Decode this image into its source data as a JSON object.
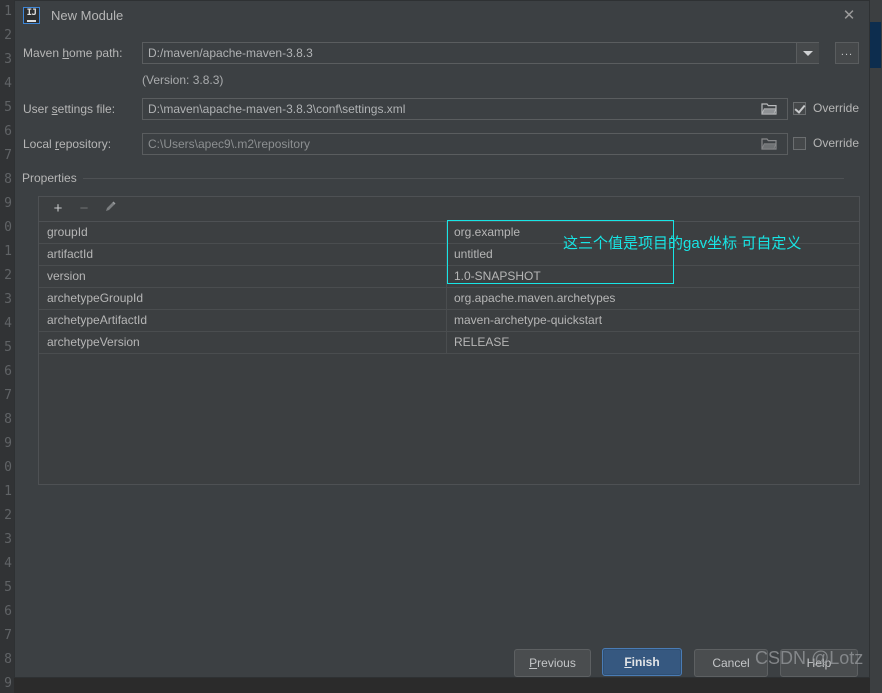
{
  "background": {
    "line_numbers": [
      "1",
      "2",
      "3",
      "4",
      "5",
      "6",
      "7",
      "8",
      "9",
      "0",
      "1",
      "2",
      "3",
      "4",
      "5",
      "6",
      "7",
      "8",
      "9",
      "0",
      "1",
      "2",
      "3",
      "4",
      "5",
      "6",
      "7",
      "8",
      "9"
    ]
  },
  "dialog": {
    "title": "New Module",
    "icon": "intellij-idea-icon",
    "close_label": "✕"
  },
  "form": {
    "maven_home": {
      "label_pre": "Maven ",
      "label_key": "h",
      "label_post": "ome path:",
      "value": "D:/maven/apache-maven-3.8.3",
      "dropdown_icon": "chevron-down-icon",
      "browse_label": "..."
    },
    "version_note": "(Version: 3.8.3)",
    "user_settings": {
      "label_pre": "User ",
      "label_key": "s",
      "label_post": "ettings file:",
      "value": "D:\\maven\\apache-maven-3.8.3\\conf\\settings.xml",
      "override_label": "Override",
      "override_checked": true
    },
    "local_repository": {
      "label_pre": "Local ",
      "label_key": "r",
      "label_post": "epository:",
      "value": "C:\\Users\\apec9\\.m2\\repository",
      "override_label": "Override",
      "override_checked": false
    }
  },
  "properties": {
    "group_label": "Properties",
    "toolbar": {
      "add_label": "+",
      "remove_label": "−",
      "edit_label": "pencil-icon"
    },
    "rows": [
      {
        "key": "groupId",
        "value": "org.example"
      },
      {
        "key": "artifactId",
        "value": "untitled"
      },
      {
        "key": "version",
        "value": "1.0-SNAPSHOT"
      },
      {
        "key": "archetypeGroupId",
        "value": "org.apache.maven.archetypes"
      },
      {
        "key": "archetypeArtifactId",
        "value": "maven-archetype-quickstart"
      },
      {
        "key": "archetypeVersion",
        "value": "RELEASE"
      }
    ]
  },
  "annotation": {
    "text": "这三个值是项目的gav坐标 可自定义",
    "color": "#17e5e5"
  },
  "buttons": {
    "previous": {
      "pre": "",
      "key": "P",
      "post": "revious"
    },
    "finish": {
      "pre": "",
      "key": "F",
      "post": "inish"
    },
    "cancel": {
      "pre": "Cancel",
      "key": "",
      "post": ""
    },
    "help": {
      "pre": "Help",
      "key": "",
      "post": ""
    }
  },
  "watermark": "CSDN @Lotz",
  "colors": {
    "dialog_bg": "#3c4043",
    "table_bg": "#3c3f41",
    "accent_blue": "#365880",
    "annotation_cyan": "#17e5e5",
    "text": "#b6b6b6"
  }
}
